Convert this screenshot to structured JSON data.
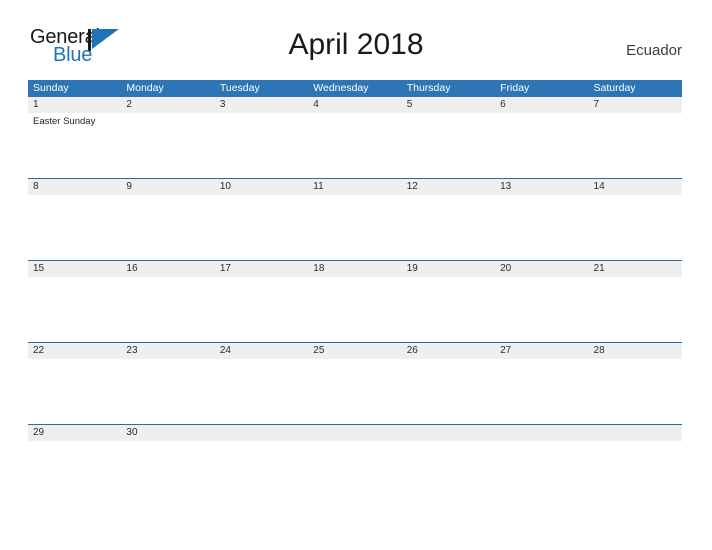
{
  "brand": {
    "name_part1": "General",
    "name_part2": "Blue"
  },
  "header": {
    "title": "April 2018",
    "country": "Ecuador"
  },
  "calendar": {
    "weekdays": [
      "Sunday",
      "Monday",
      "Tuesday",
      "Wednesday",
      "Thursday",
      "Friday",
      "Saturday"
    ],
    "weeks": [
      {
        "dates": [
          "1",
          "2",
          "3",
          "4",
          "5",
          "6",
          "7"
        ],
        "events": [
          [
            "Easter Sunday"
          ],
          [],
          [],
          [],
          [],
          [],
          []
        ]
      },
      {
        "dates": [
          "8",
          "9",
          "10",
          "11",
          "12",
          "13",
          "14"
        ],
        "events": [
          [],
          [],
          [],
          [],
          [],
          [],
          []
        ]
      },
      {
        "dates": [
          "15",
          "16",
          "17",
          "18",
          "19",
          "20",
          "21"
        ],
        "events": [
          [],
          [],
          [],
          [],
          [],
          [],
          []
        ]
      },
      {
        "dates": [
          "22",
          "23",
          "24",
          "25",
          "26",
          "27",
          "28"
        ],
        "events": [
          [],
          [],
          [],
          [],
          [],
          [],
          []
        ]
      },
      {
        "dates": [
          "29",
          "30",
          "",
          "",
          "",
          "",
          ""
        ],
        "events": [
          [],
          [],
          [],
          [],
          [],
          [],
          []
        ],
        "no_event_strip": true
      }
    ]
  },
  "colors": {
    "header_blue": "#2e75b6",
    "row_line_blue": "#2e6da4",
    "date_strip_gray": "#efefef",
    "brand_blue": "#2272b8"
  }
}
